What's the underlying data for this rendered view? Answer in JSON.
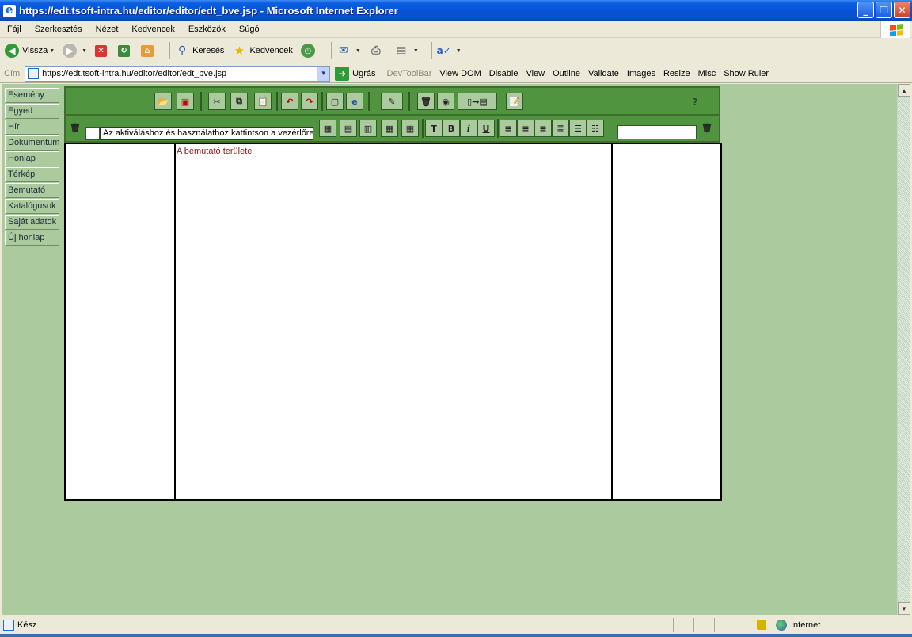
{
  "window": {
    "title": "https://edt.tsoft-intra.hu/editor/editor/edt_bve.jsp - Microsoft Internet Explorer",
    "min_glyph": "_",
    "max_glyph": "❐",
    "close_glyph": "✕"
  },
  "menu": [
    "Fájl",
    "Szerkesztés",
    "Nézet",
    "Kedvencek",
    "Eszközök",
    "Súgó"
  ],
  "toolbar": {
    "back_label": "Vissza",
    "search_label": "Keresés",
    "favorites_label": "Kedvencek"
  },
  "address": {
    "label": "Cím",
    "url": "https://edt.tsoft-intra.hu/editor/editor/edt_bve.jsp",
    "go_label": "Ugrás"
  },
  "devtools": [
    "DevToolBar",
    "View DOM",
    "Disable",
    "View",
    "Outline",
    "Validate",
    "Images",
    "Resize",
    "Misc",
    "Show Ruler"
  ],
  "nav": [
    "Esemény",
    "Egyed",
    "Hír",
    "Dokumentum",
    "Honlap",
    "Térkép",
    "Bemutató",
    "Katalógusok",
    "Saját adatok",
    "Új honlap"
  ],
  "editor": {
    "hint_text": "Az aktiváláshoz és használathoz kattintson a vezérlőre.",
    "help_glyph": "?",
    "demo_text": "A bemutató területe"
  },
  "status": {
    "text": "Kész",
    "zone": "Internet"
  },
  "colors": {
    "content_bg": "#abcb9f",
    "editor_toolbar": "#51943f",
    "titlebar": "#0553d6"
  }
}
